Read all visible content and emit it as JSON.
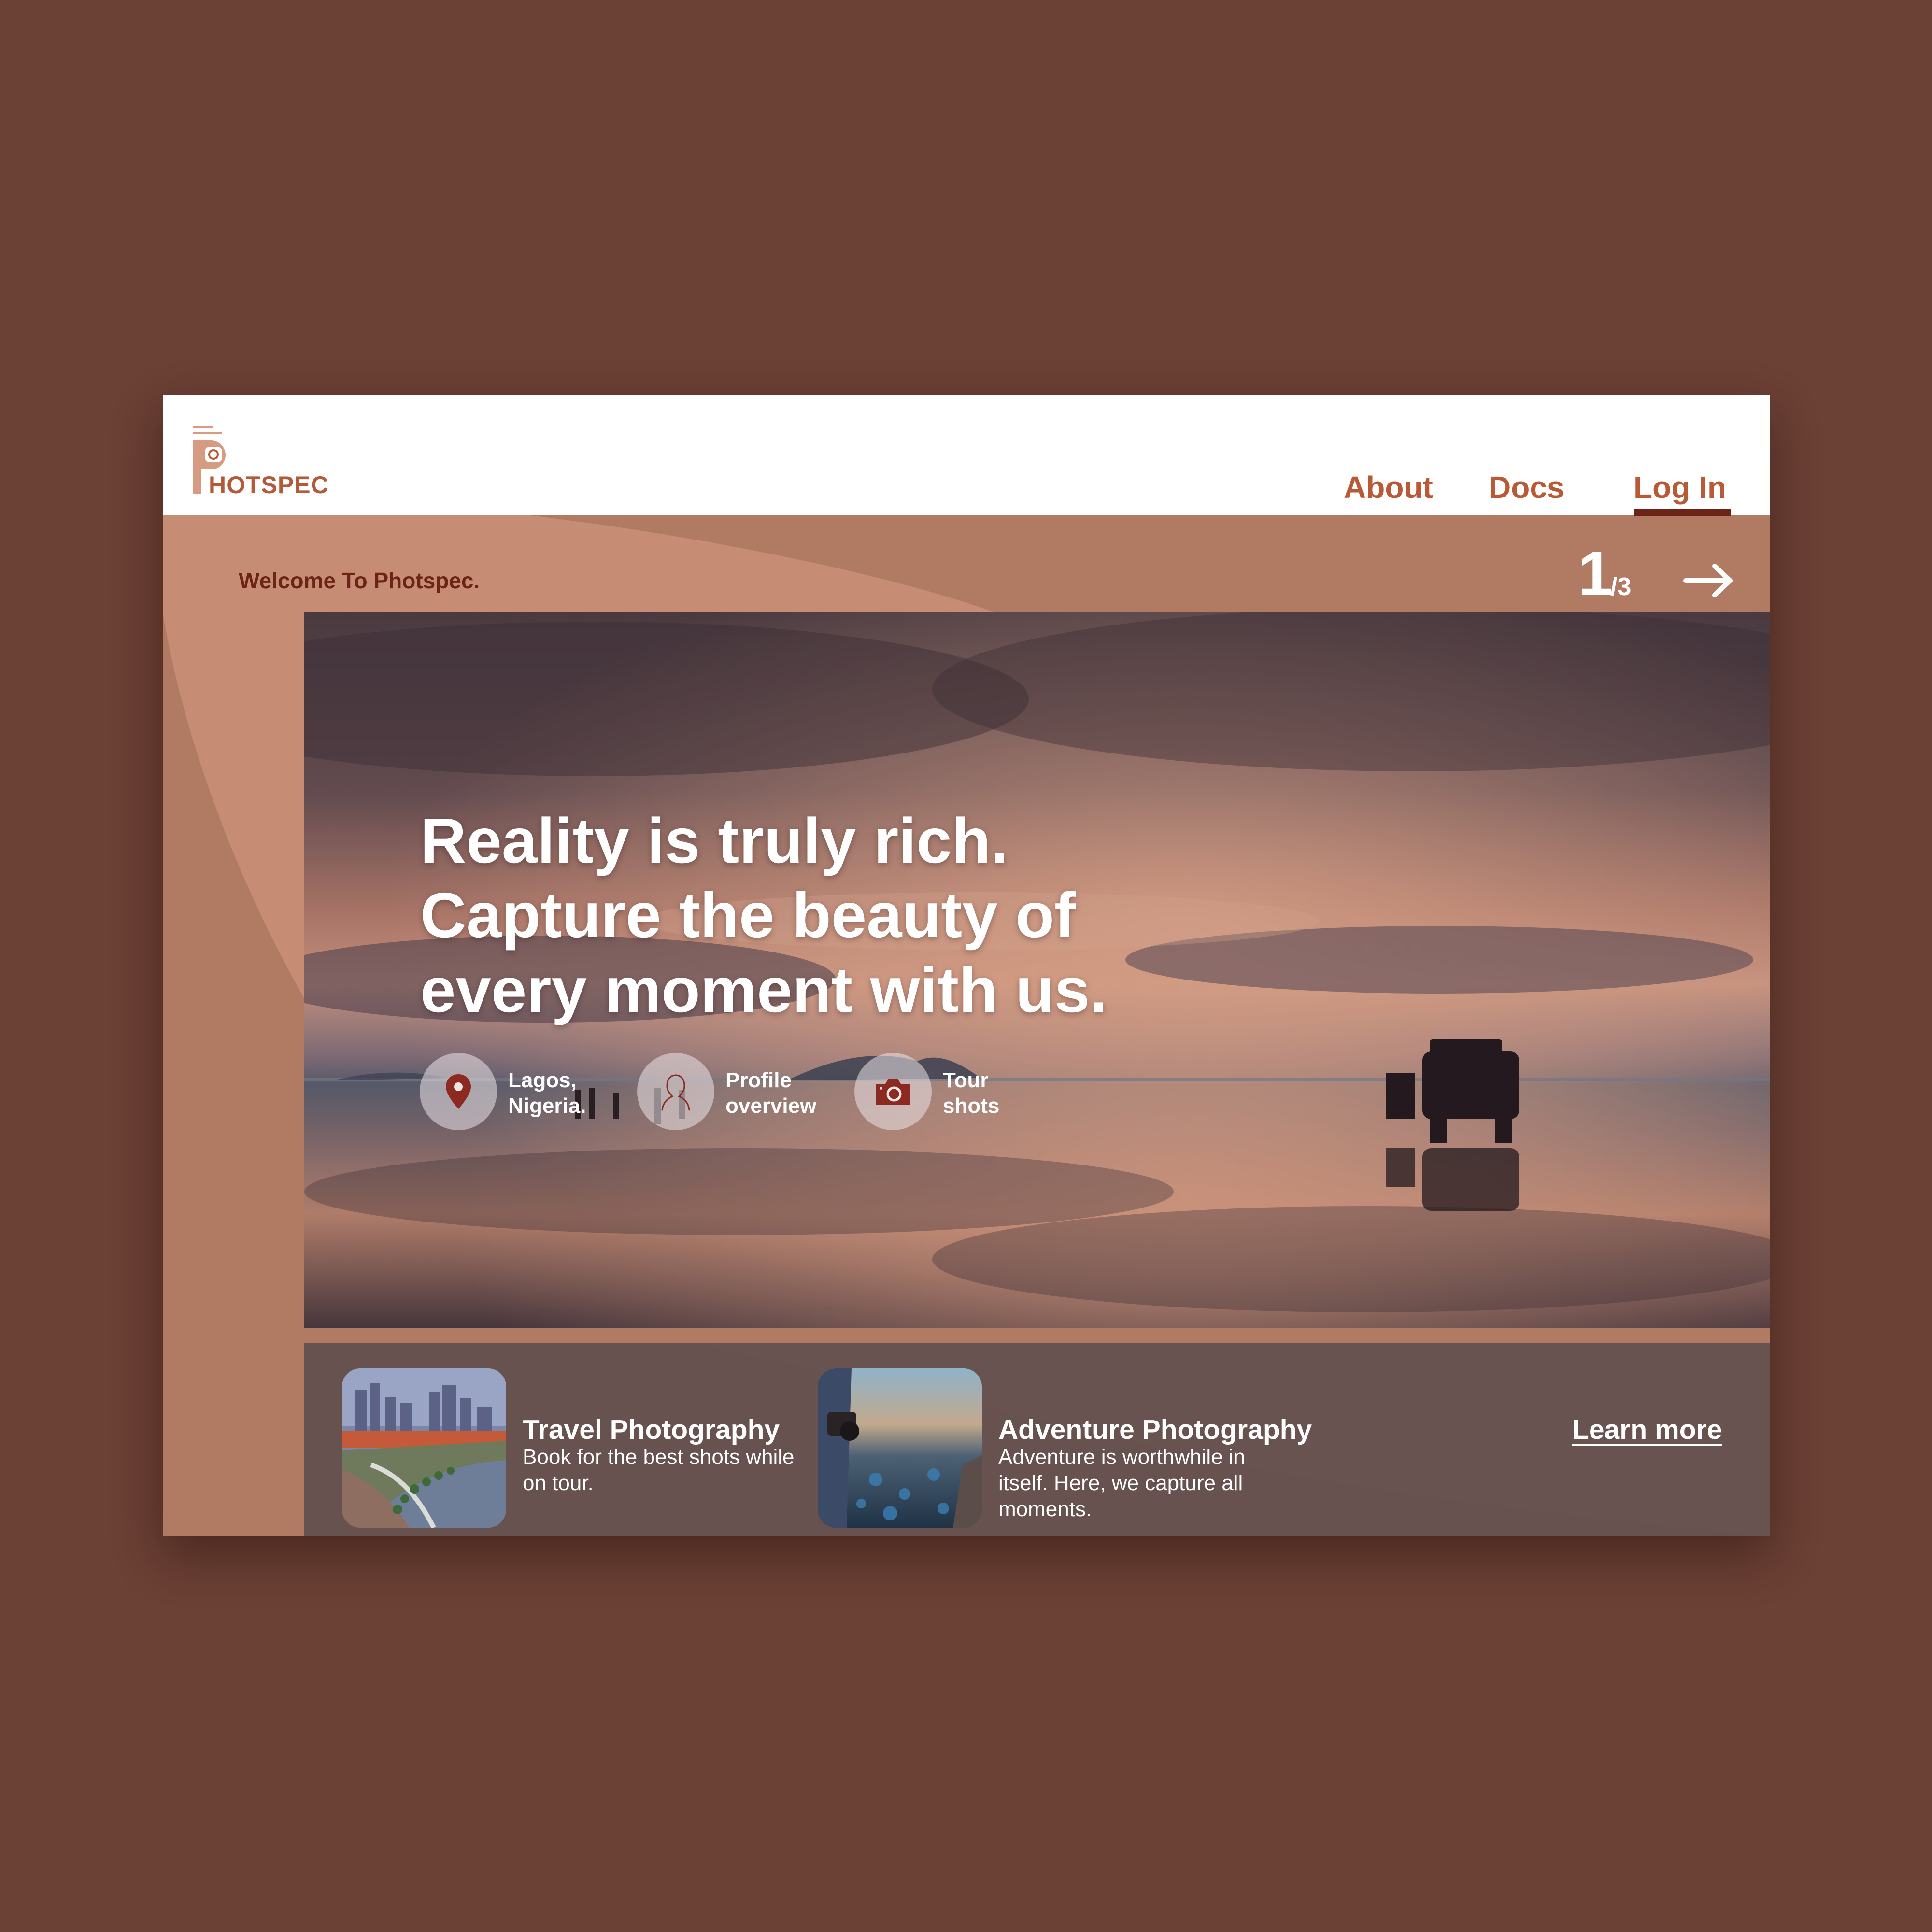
{
  "brand": {
    "logo_text": "HOTSPEC",
    "accent_color": "#b85a36"
  },
  "nav": {
    "about": "About",
    "docs": "Docs",
    "login": "Log In"
  },
  "welcome": "Welcome To Photspec.",
  "pager": {
    "current": "1",
    "total": "/3"
  },
  "hero": {
    "headline": [
      "Reality is truly rich.",
      "Capture the beauty of",
      "every moment with us."
    ],
    "features": [
      {
        "icon": "location-pin-icon",
        "line1": "Lagos,",
        "line2": "Nigeria."
      },
      {
        "icon": "profile-icon",
        "line1": "Profile",
        "line2": "overview"
      },
      {
        "icon": "camera-icon",
        "line1": "Tour",
        "line2": "shots"
      }
    ]
  },
  "cards": [
    {
      "title": "Travel Photography",
      "description": "Book for the best shots while on tour."
    },
    {
      "title": "Adventure  Photography",
      "description": "Adventure is worthwhile in itself. Here, we capture all moments."
    }
  ],
  "learn_more": "Learn more"
}
